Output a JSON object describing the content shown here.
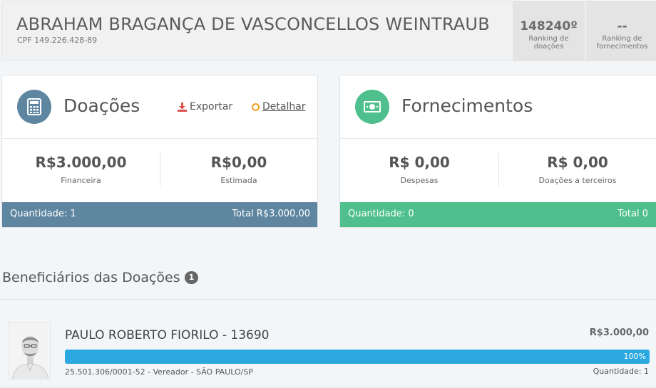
{
  "header": {
    "name": "ABRAHAM BRAGANÇA DE VASCONCELLOS WEINTRAUB",
    "cpf": "CPF 149.226.428-89",
    "ranking_donations": {
      "value": "148240º",
      "label": "Ranking de doações"
    },
    "ranking_supplies": {
      "value": "--",
      "label": "Ranking de fornecimentos"
    }
  },
  "donations": {
    "title": "Doações",
    "export_label": "Exportar",
    "detail_label": "Detalhar",
    "financial": {
      "value": "R$3.000,00",
      "label": "Financeira"
    },
    "estimated": {
      "value": "R$0,00",
      "label": "Estimada"
    },
    "footer_qty": "Quantidade: 1",
    "footer_total": "Total R$3.000,00",
    "icon": "calculator-icon",
    "color": "#5f86a0"
  },
  "supplies": {
    "title": "Fornecimentos",
    "expenses": {
      "value": "R$ 0,00",
      "label": "Despesas"
    },
    "third_party": {
      "value": "R$ 0,00",
      "label": "Doações a terceiros"
    },
    "footer_qty": "Quantidade: 0",
    "footer_total": "Total 0",
    "icon": "money-icon",
    "color": "#4fc08d"
  },
  "beneficiaries": {
    "title": "Beneficiários das Doações",
    "count": "1",
    "items": [
      {
        "name": "PAULO ROBERTO FIORILO - 13690",
        "amount": "R$3.000,00",
        "percent_label": "100%",
        "percent": 100,
        "meta": "25.501.306/0001-52 - Vereador - SÃO PAULO/SP",
        "quantity": "Quantidade: 1",
        "bar_color": "#2aa8df"
      }
    ]
  }
}
